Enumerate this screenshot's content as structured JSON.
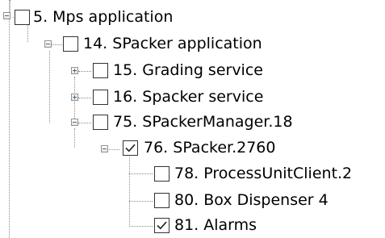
{
  "tree": {
    "nodes": [
      {
        "label": "5. Mps application",
        "checked": false,
        "expander": "collapse"
      },
      {
        "label": "14. SPacker application",
        "checked": false,
        "expander": "collapse"
      },
      {
        "label": "15. Grading service",
        "checked": false,
        "expander": "expand"
      },
      {
        "label": "16. Spacker service",
        "checked": false,
        "expander": "expand"
      },
      {
        "label": "75. SPackerManager.18",
        "checked": false,
        "expander": "collapse"
      },
      {
        "label": "76. SPacker.2760",
        "checked": true,
        "expander": "collapse"
      },
      {
        "label": "78. ProcessUnitClient.2",
        "checked": false,
        "expander": "none"
      },
      {
        "label": "80. Box Dispenser 4",
        "checked": false,
        "expander": "none"
      },
      {
        "label": "81. Alarms",
        "checked": true,
        "expander": "none"
      }
    ]
  },
  "colors": {
    "guide_line": "#8a8a8a",
    "expander_border": "#919191",
    "expander_sign": "#4b6c8f",
    "checkbox_border": "#333333",
    "checkmark": "#222222"
  }
}
